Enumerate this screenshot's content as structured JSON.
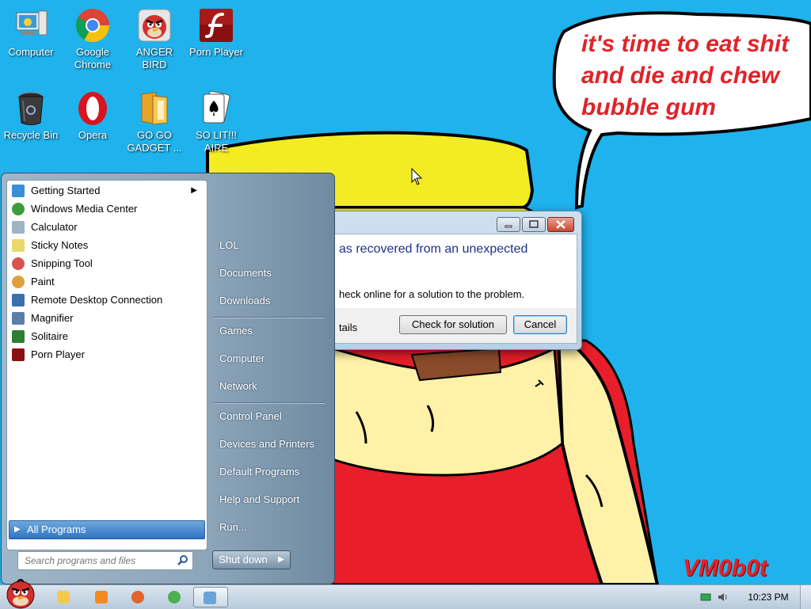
{
  "desktop": {
    "icons": [
      {
        "label": "Computer",
        "icon": "computer-icon"
      },
      {
        "label": "Google Chrome",
        "icon": "chrome-icon"
      },
      {
        "label": "ANGER BIRD",
        "icon": "angry-bird-icon"
      },
      {
        "label": "Porn Player",
        "icon": "flash-player-icon"
      },
      {
        "label": "Recycle Bin",
        "icon": "recycle-bin-icon"
      },
      {
        "label": "Opera",
        "icon": "opera-icon"
      },
      {
        "label": "GO GO GADGET ...",
        "icon": "folder-icon"
      },
      {
        "label": "SO LIT!!! AIRE",
        "icon": "solitaire-icon"
      }
    ],
    "speech_bubble": [
      "it's time to eat shit",
      "and die and chew",
      "bubble gum"
    ],
    "watermark": "VM0b0t",
    "colors": {
      "background": "#1fb2ec",
      "accent_red": "#e0232a",
      "hat_yellow": "#f4ec22"
    }
  },
  "dialog": {
    "message_title": "as recovered from an unexpected",
    "message_text": "heck online for a solution to the problem.",
    "details_label": "tails",
    "check_button": "Check for solution",
    "cancel_button": "Cancel"
  },
  "start_menu": {
    "programs": [
      {
        "label": "Getting Started",
        "icon": "getting-started-icon",
        "has_submenu": true,
        "color": "#3b8fd6"
      },
      {
        "label": "Windows Media Center",
        "icon": "media-center-icon",
        "has_submenu": false,
        "color": "#3e9b3e"
      },
      {
        "label": "Calculator",
        "icon": "calculator-icon",
        "has_submenu": false,
        "color": "#9fb3c3"
      },
      {
        "label": "Sticky Notes",
        "icon": "sticky-notes-icon",
        "has_submenu": false,
        "color": "#e8d96a"
      },
      {
        "label": "Snipping Tool",
        "icon": "scissors-icon",
        "has_submenu": false,
        "color": "#d9534f"
      },
      {
        "label": "Paint",
        "icon": "paint-icon",
        "has_submenu": false,
        "color": "#e0a040"
      },
      {
        "label": "Remote Desktop Connection",
        "icon": "remote-desktop-icon",
        "has_submenu": false,
        "color": "#3a6fb0"
      },
      {
        "label": "Magnifier",
        "icon": "magnifier-icon",
        "has_submenu": false,
        "color": "#5b7fa8"
      },
      {
        "label": "Solitaire",
        "icon": "solitaire-icon",
        "has_submenu": false,
        "color": "#2e7d32"
      },
      {
        "label": "Porn Player",
        "icon": "flash-player-icon",
        "has_submenu": false,
        "color": "#8b1010"
      }
    ],
    "all_programs": "All Programs",
    "search_placeholder": "Search programs and files",
    "right_items": [
      "LOL",
      "Documents",
      "Downloads",
      "Games",
      "Computer",
      "Network",
      "Control Panel",
      "Devices and Printers",
      "Default Programs",
      "Help and Support",
      "Run..."
    ],
    "shutdown_label": "Shut down"
  },
  "taskbar": {
    "pinned": [
      {
        "icon": "explorer-icon",
        "color": "#f2c94c"
      },
      {
        "icon": "media-player-icon",
        "color": "#f28a1e"
      },
      {
        "icon": "firefox-icon",
        "color": "#e2632b"
      },
      {
        "icon": "chrome-icon",
        "color": "#4caf50"
      },
      {
        "icon": "running-app-icon",
        "color": "#6aa3d8"
      }
    ],
    "clock": "10:23 PM"
  }
}
